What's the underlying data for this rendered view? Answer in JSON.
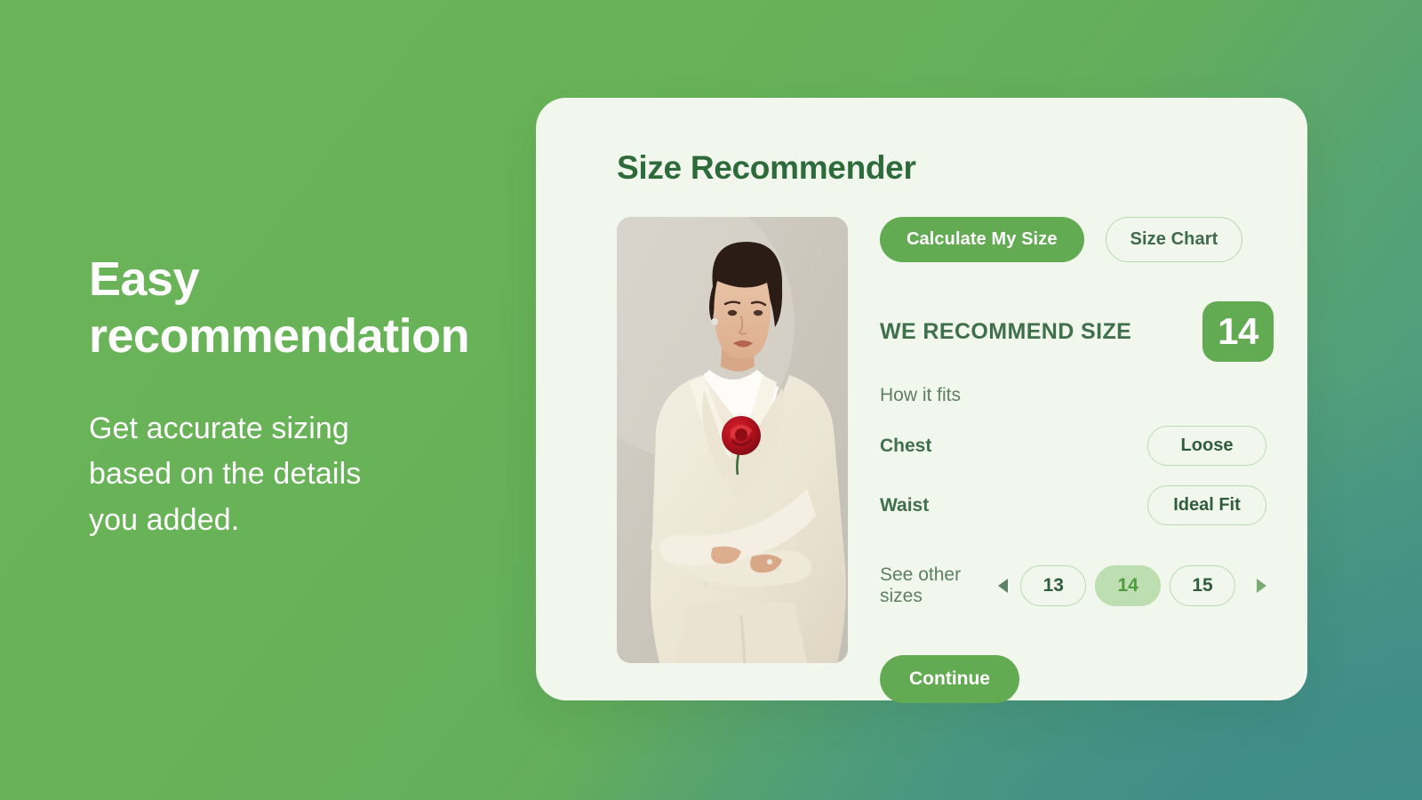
{
  "theme": {
    "bg_green": "#6bb45a",
    "bg_teal": "#479389",
    "card_bg": "#f2f7ee",
    "accent_green": "#63ab52",
    "dark_green": "#2e6b3b",
    "pill_border": "#bcddb4",
    "selected_pill_bg": "#bcdeb0"
  },
  "hero": {
    "title": "Easy\nrecommendation",
    "subtitle": "Get accurate sizing\nbased on the details\nyou added."
  },
  "card": {
    "title": "Size Recommender",
    "tabs": [
      {
        "label": "Calculate My Size",
        "style": "primary",
        "active": true
      },
      {
        "label": "Size Chart",
        "style": "outline",
        "active": false
      }
    ],
    "product_image": {
      "alt": "Woman wearing cream ivory blazer suit with red rose brooch"
    },
    "recommendation": {
      "label": "WE RECOMMEND SIZE",
      "size": "14"
    },
    "fit": {
      "heading": "How it fits",
      "rows": [
        {
          "label": "Chest",
          "value": "Loose"
        },
        {
          "label": "Waist",
          "value": "Ideal Fit"
        }
      ]
    },
    "other_sizes": {
      "label": "See other sizes",
      "prev_icon": "caret-left-icon",
      "next_icon": "caret-right-icon",
      "options": [
        {
          "value": "13",
          "selected": false
        },
        {
          "value": "14",
          "selected": true
        },
        {
          "value": "15",
          "selected": false
        }
      ]
    },
    "continue_label": "Continue"
  }
}
